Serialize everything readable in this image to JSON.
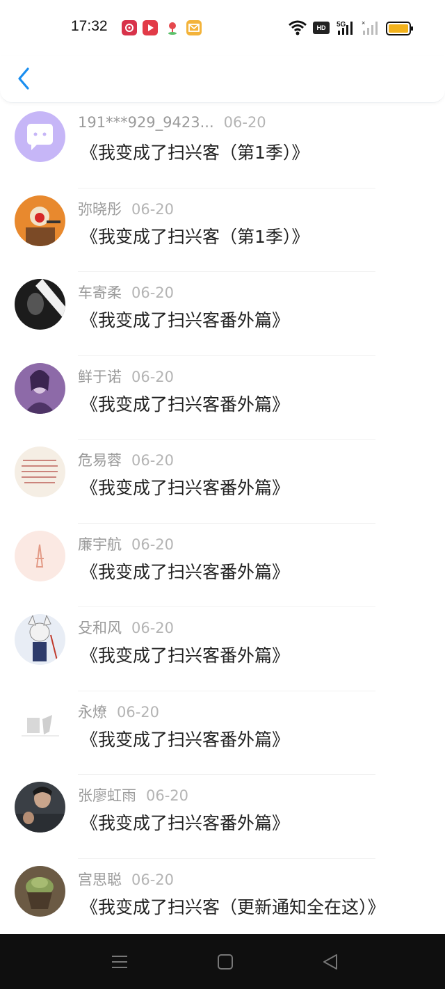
{
  "status_bar": {
    "time": "17:32",
    "icons": [
      "app-red-icon",
      "video-app-icon",
      "map-pin-icon",
      "mail-app-icon",
      "wifi-icon",
      "hd-icon",
      "signal-5g-icon",
      "signal-icon",
      "battery-icon"
    ],
    "hd_label": "HD"
  },
  "header": {
    "back_icon": "chevron-left-icon",
    "accent": "#1a8ef0"
  },
  "list": [
    {
      "name": "191***929_9423...",
      "date": "06-20",
      "title": "《我变成了扫兴客（第1季）》",
      "avatar": "chat-bubble-avatar"
    },
    {
      "name": "弥晓彤",
      "date": "06-20",
      "title": "《我变成了扫兴客（第1季）》",
      "avatar": "character-avatar"
    },
    {
      "name": "车寄柔",
      "date": "06-20",
      "title": "《我变成了扫兴客番外篇》",
      "avatar": "dark-portrait-avatar"
    },
    {
      "name": "鲜于诺",
      "date": "06-20",
      "title": "《我变成了扫兴客番外篇》",
      "avatar": "purple-portrait-avatar"
    },
    {
      "name": "危易蓉",
      "date": "06-20",
      "title": "《我变成了扫兴客番外篇》",
      "avatar": "handwriting-avatar"
    },
    {
      "name": "廉宇航",
      "date": "06-20",
      "title": "《我变成了扫兴客番外篇》",
      "avatar": "tower-avatar"
    },
    {
      "name": "殳和风",
      "date": "06-20",
      "title": "《我变成了扫兴客番外篇》",
      "avatar": "anime-avatar"
    },
    {
      "name": "永燎",
      "date": "06-20",
      "title": "《我变成了扫兴客番外篇》",
      "avatar": "grey-sketch-avatar"
    },
    {
      "name": "张廖虹雨",
      "date": "06-20",
      "title": "《我变成了扫兴客番外篇》",
      "avatar": "photo-avatar"
    },
    {
      "name": "宫思聪",
      "date": "06-20",
      "title": "《我变成了扫兴客（更新通知全在这）》",
      "avatar": "cupcake-avatar"
    }
  ],
  "nav_bar": {
    "icons": [
      "menu-icon",
      "home-icon",
      "back-triangle-icon"
    ]
  }
}
